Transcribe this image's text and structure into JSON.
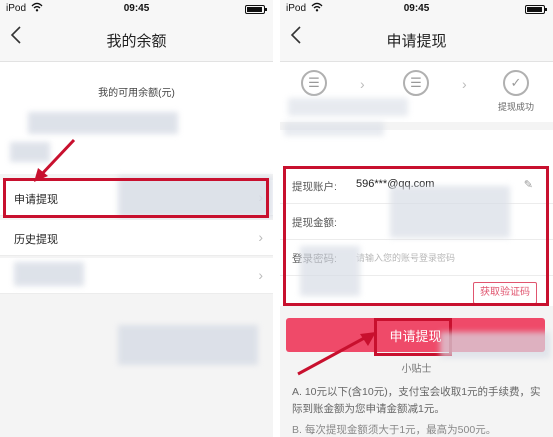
{
  "status_bar": {
    "carrier": "iPod",
    "time": "09:45",
    "wifi_icon": "wifi-icon",
    "battery_icon": "battery-icon"
  },
  "left_screen": {
    "title": "我的余额",
    "back_icon": "chevron-left-icon",
    "balance_label": "我的可用余额(元)",
    "menu": [
      {
        "label": "申请提现",
        "chevron": "›"
      },
      {
        "label": "历史提现",
        "chevron": "›"
      },
      {
        "label": "",
        "chevron": "›"
      }
    ]
  },
  "right_screen": {
    "title": "申请提现",
    "back_icon": "chevron-left-icon",
    "steps": [
      {
        "label": "",
        "icon": "document-icon"
      },
      {
        "label": "",
        "icon": "document-icon"
      },
      {
        "label": "提现成功",
        "icon": "check-circle-icon"
      }
    ],
    "form": {
      "account_label": "提现账户:",
      "account_value": "596***@qq.com",
      "amount_label": "提现金额:",
      "amount_placeholder": "",
      "password_label": "登录密码:",
      "password_placeholder": "请输入您的账号登录密码",
      "code_button": "获取验证码"
    },
    "submit_label": "申请提现",
    "tips_title": "小贴士",
    "tips": [
      "A. 10元以下(含10元)，支付宝会收取1元的手续费，实际到账金额为您申请金额减1元。",
      "B. 每次提现金额须大于1元，最高为500元。"
    ]
  },
  "colors": {
    "accent": "#ef4a69",
    "highlight": "#c8102e",
    "background": "#f4f4f4"
  }
}
